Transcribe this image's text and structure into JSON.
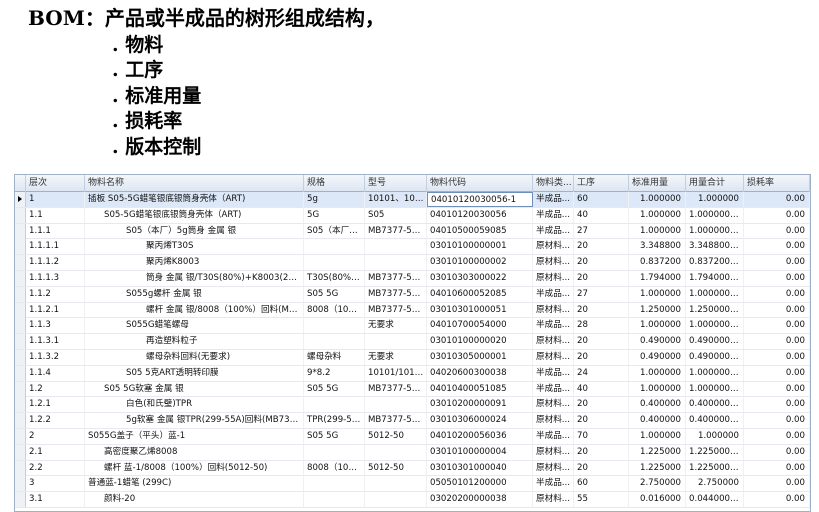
{
  "slide": {
    "title": "BOM：产品或半成品的树形组成结构，",
    "bullets": [
      ". 物料",
      ". 工序",
      ". 标准用量",
      ". 损耗率",
      ". 版本控制"
    ]
  },
  "grid": {
    "columns": [
      "层次",
      "物料名称",
      "规格",
      "型号",
      "物料代码",
      "物料类...",
      "工序",
      "标准用量",
      "用量合计",
      "损耗率"
    ],
    "current_row_indicator": "row-pointer-icon",
    "rows": [
      [
        "1",
        "插板 S05-5G蜡笔银底银筒身壳体（ART)",
        "5g",
        "10101、102...",
        "04010120030056-1",
        "半成品...",
        "60",
        "1.000000",
        "1.000000",
        "0.00"
      ],
      [
        "1.1",
        "S05-5G蜡笔银底银筒身壳体（ART)",
        "5G",
        "S05",
        "04010120030056",
        "半成品...",
        "40",
        "1.000000",
        "1.0000000...",
        "0.00"
      ],
      [
        "1.1.1",
        "S05（本厂）5g筒身 金属 银",
        "S05（本厂）...",
        "MB7377-50...",
        "04010500059085",
        "半成品...",
        "27",
        "1.000000",
        "1.0000000...",
        "0.00"
      ],
      [
        "1.1.1.1",
        "聚丙烯T30S",
        "",
        "",
        "03010100000001",
        "原材料...",
        "20",
        "3.348800",
        "3.3488000...",
        "0.00"
      ],
      [
        "1.1.1.2",
        "聚丙烯K8003",
        "",
        "",
        "03010100000002",
        "原材料...",
        "20",
        "0.837200",
        "0.8372000...",
        "0.00"
      ],
      [
        "1.1.1.3",
        "筒身 金属 银/T30S(80%)+K8003(20%)...",
        "T30S(80%)...",
        "MB7377-50...",
        "03010303000022",
        "原材料...",
        "20",
        "1.794000",
        "1.7940000...",
        "0.00"
      ],
      [
        "1.1.2",
        "S055g螺杆 金属 银",
        "S05 5G",
        "MB7377-50...",
        "04010600052085",
        "半成品...",
        "27",
        "1.000000",
        "1.0000000...",
        "0.00"
      ],
      [
        "1.1.2.1",
        "螺杆 金属 银/8008（100%）回料(MB7...",
        "8008（100...",
        "MB7377-50...",
        "03010301000051",
        "原材料...",
        "20",
        "1.250000",
        "1.2500000...",
        "0.00"
      ],
      [
        "1.1.3",
        "S055G蜡笔螺母",
        "",
        "无要求",
        "04010700054000",
        "半成品...",
        "28",
        "1.000000",
        "1.0000000...",
        "0.00"
      ],
      [
        "1.1.3.1",
        "再造塑料粒子",
        "",
        "",
        "03010100000020",
        "原材料...",
        "20",
        "0.490000",
        "0.4900000...",
        "0.00"
      ],
      [
        "1.1.3.2",
        "螺母杂料回料(无要求)",
        "螺母杂料",
        "无要求",
        "03010305000001",
        "原材料...",
        "20",
        "0.490000",
        "0.4900000...",
        "0.00"
      ],
      [
        "1.1.4",
        "S05 5克ART透明转印膜",
        "9*8.2",
        "10101/1011...",
        "04020600300038",
        "半成品...",
        "24",
        "1.000000",
        "1.0000000...",
        "0.00"
      ],
      [
        "1.2",
        "S05 5G软塞 金属 银",
        "S05 5G",
        "MB7377-50...",
        "04010400051085",
        "半成品...",
        "40",
        "1.000000",
        "1.0000000...",
        "0.00"
      ],
      [
        "1.2.1",
        "白色(和氏璧)TPR",
        "",
        "",
        "03010200000091",
        "原材料...",
        "20",
        "0.400000",
        "0.4000000...",
        "0.00"
      ],
      [
        "1.2.2",
        "5g软塞 金属 银TPR(299-55A)回料(MB7377...",
        "TPR(299-55A)",
        "MB7377-50...",
        "03010306000024",
        "原材料...",
        "20",
        "0.400000",
        "0.4000000...",
        "0.00"
      ],
      [
        "2",
        "S055G盖子（平头）蓝-1",
        "S05 5G",
        "5012-50",
        "04010200056036",
        "半成品...",
        "70",
        "1.000000",
        "1.000000",
        "0.00"
      ],
      [
        "2.1",
        "高密度聚乙烯8008",
        "",
        "",
        "03010100000004",
        "原材料...",
        "20",
        "1.225000",
        "1.2250000...",
        "0.00"
      ],
      [
        "2.2",
        "螺杆 蓝-1/8008（100%）回料(5012-50)",
        "8008（100...",
        "5012-50",
        "03010301000040",
        "原材料...",
        "20",
        "1.225000",
        "1.2250000...",
        "0.00"
      ],
      [
        "3",
        "普通蓝-1蜡笔 (299C)",
        "",
        "",
        "05050101200000",
        "半成品...",
        "60",
        "2.750000",
        "2.750000",
        "0.00"
      ],
      [
        "3.1",
        "颜料-20",
        "",
        "",
        "03020200000038",
        "原材料...",
        "55",
        "0.016000",
        "0.0440000...",
        "0.00"
      ]
    ]
  }
}
